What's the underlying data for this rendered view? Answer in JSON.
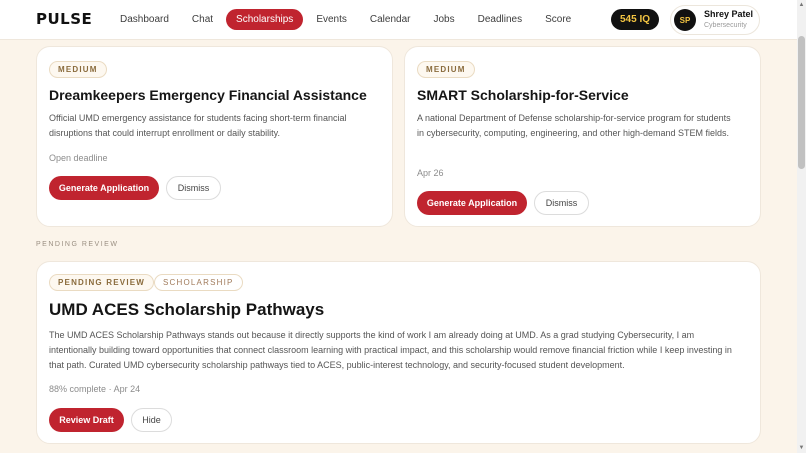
{
  "app": {
    "logo": "PULSE"
  },
  "nav": {
    "items": [
      {
        "label": "Dashboard"
      },
      {
        "label": "Chat"
      },
      {
        "label": "Scholarships"
      },
      {
        "label": "Events"
      },
      {
        "label": "Calendar"
      },
      {
        "label": "Jobs"
      },
      {
        "label": "Deadlines"
      },
      {
        "label": "Score"
      }
    ],
    "active": "Scholarships"
  },
  "header": {
    "iq_badge": "545 IQ",
    "user": {
      "initials": "SP",
      "name": "Shrey Patel",
      "subtitle": "Cybersecurity"
    }
  },
  "cards": [
    {
      "priority": "MEDIUM",
      "title": "Dreamkeepers Emergency Financial Assistance",
      "description": "Official UMD emergency assistance for students facing short-term financial disruptions that could interrupt enrollment or daily stability.",
      "meta": "Open deadline",
      "primary_action": "Generate Application",
      "secondary_action": "Dismiss"
    },
    {
      "priority": "MEDIUM",
      "title": "SMART Scholarship-for-Service",
      "description": "A national Department of Defense scholarship-for-service program for students in cybersecurity, computing, engineering, and other high-demand STEM fields.",
      "meta": "Apr 26",
      "primary_action": "Generate Application",
      "secondary_action": "Dismiss"
    }
  ],
  "pending": {
    "section_label": "PENDING REVIEW",
    "status_pill": "PENDING REVIEW",
    "type_pill": "SCHOLARSHIP",
    "title": "UMD ACES Scholarship Pathways",
    "description": "The UMD ACES Scholarship Pathways stands out because it directly supports the kind of work I am already doing at UMD. As a grad studying Cybersecurity, I am intentionally building toward opportunities that connect classroom learning with practical impact, and this scholarship would remove financial friction while I keep investing in that path. Curated UMD cybersecurity scholarship pathways tied to ACES, public-interest technology, and security-focused student development.",
    "progress": "88% complete",
    "separator": "·",
    "date": "Apr 24",
    "primary_action": "Review Draft",
    "secondary_action": "Hide"
  },
  "colors": {
    "accent": "#c0242f",
    "background": "#fbf4ea",
    "badge_bg": "#111111",
    "badge_text": "#f4c542"
  },
  "scrollbar": {
    "up_icon": "▲",
    "down_icon": "▼"
  }
}
